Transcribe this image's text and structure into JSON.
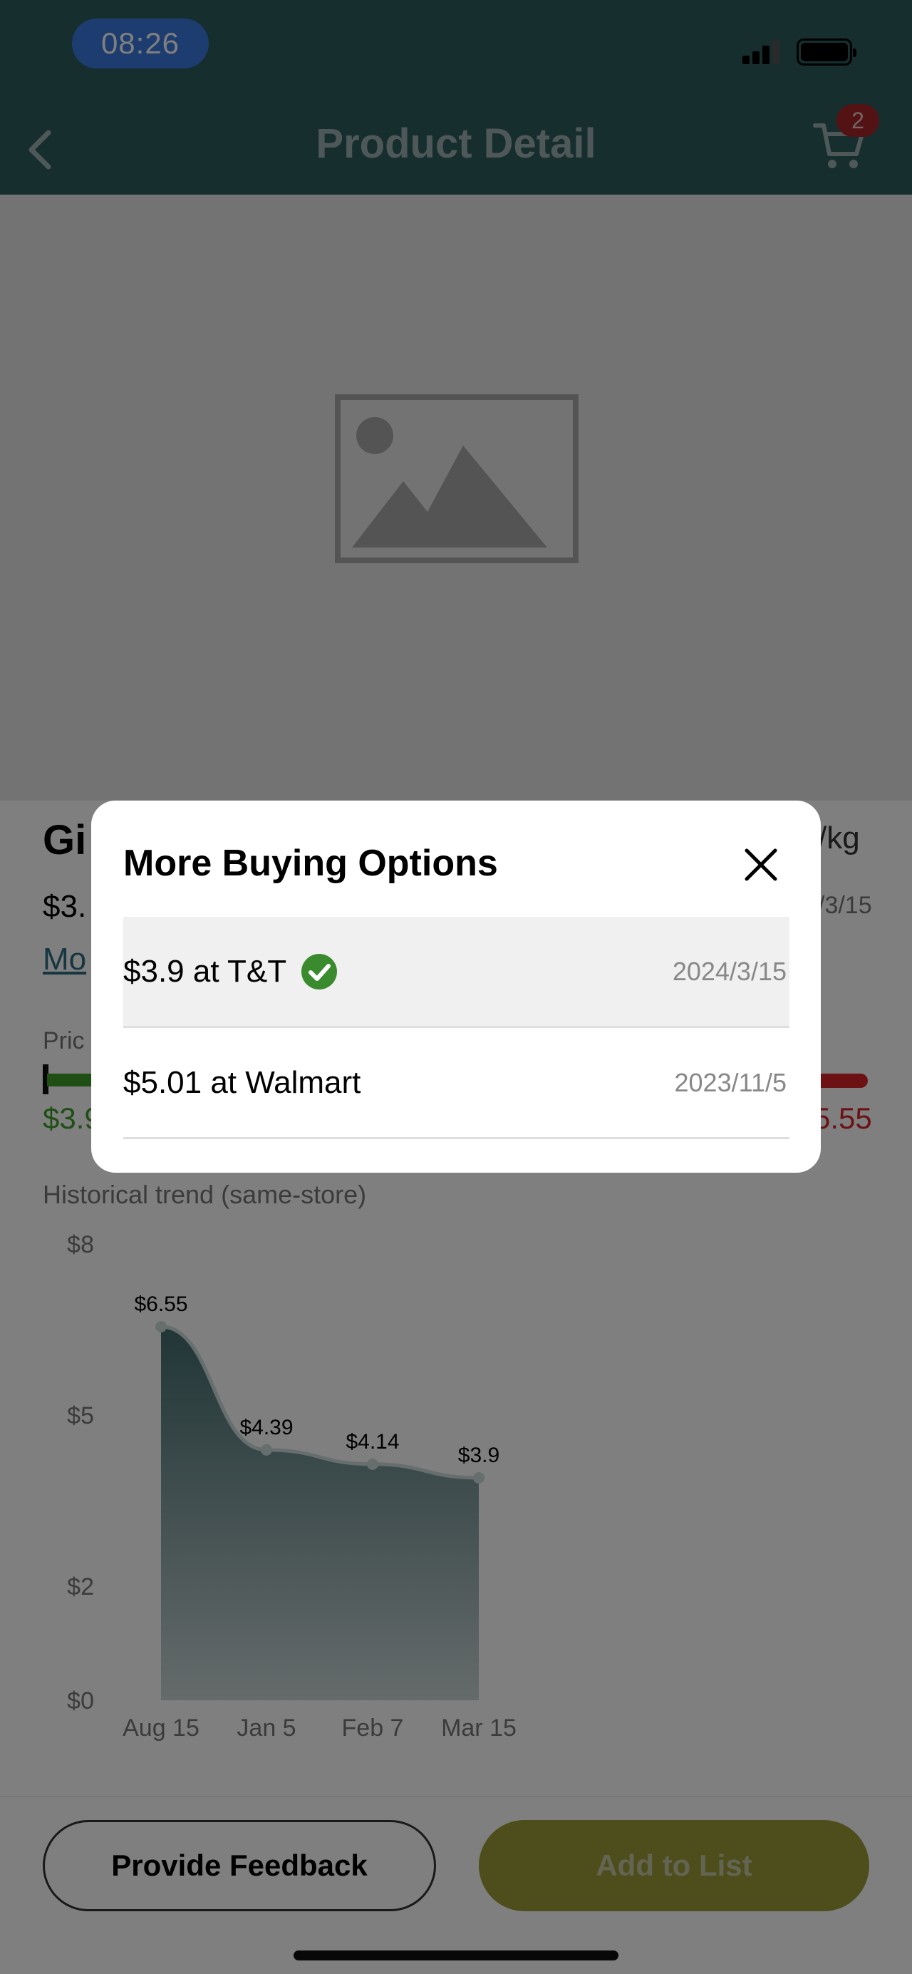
{
  "status": {
    "time": "08:26"
  },
  "nav": {
    "title": "Product Detail",
    "cart_count": "2"
  },
  "product": {
    "name_partial": "Gi",
    "unit_partial": "/kg",
    "price_partial": "$3.",
    "date_partial": "/3/15",
    "more_link_partial": "Mo",
    "price_range_label_partial": "Pric",
    "price_low_partial": "$3.9",
    "price_high_partial": "5.55",
    "price_range_low_color": "#3f9e2b",
    "price_range_high_color": "#d9252b"
  },
  "history": {
    "title": "Historical trend (same-store)"
  },
  "chart_data": {
    "type": "area",
    "title": "Historical trend (same-store)",
    "categories": [
      "Aug 15",
      "Jan 5",
      "Feb 7",
      "Mar 15"
    ],
    "values": [
      6.55,
      4.39,
      4.14,
      3.9
    ],
    "data_labels": [
      "$6.55",
      "$4.39",
      "$4.14",
      "$3.9"
    ],
    "y_ticks": [
      0,
      2,
      5,
      8
    ],
    "y_tick_labels": [
      "$0",
      "$2",
      "$5",
      "$8"
    ],
    "ylim": [
      0,
      8
    ],
    "xlabel": "",
    "ylabel": "",
    "grid": false,
    "color": "#2f5c5e"
  },
  "modal": {
    "title": "More Buying Options",
    "options": [
      {
        "label": "$3.9 at T&T",
        "date": "2024/3/15",
        "selected": true
      },
      {
        "label": "$5.01 at Walmart",
        "date": "2023/11/5",
        "selected": false
      }
    ]
  },
  "actions": {
    "feedback_label": "Provide Feedback",
    "add_label": "Add to List"
  },
  "icons": {
    "back": "chevron-left-icon",
    "cart": "shopping-cart-icon",
    "placeholder": "image-placeholder-icon",
    "close": "close-icon",
    "check": "check-circle-icon"
  }
}
